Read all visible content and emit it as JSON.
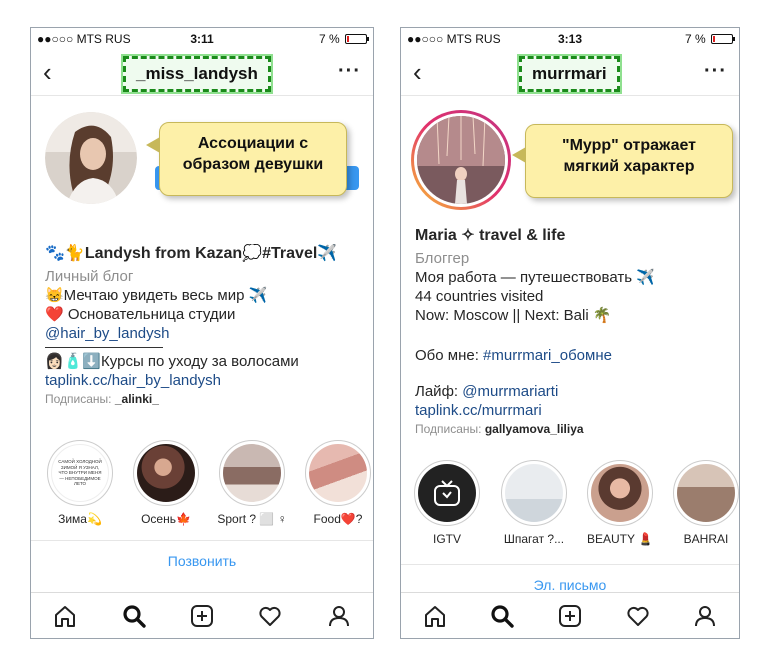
{
  "left": {
    "status": {
      "carrier": "●●○○○ MTS RUS",
      "time": "3:11",
      "battery_text": "7 %"
    },
    "username": "_miss_landysh",
    "callout": "Ассоциации с образом девушки",
    "bio": {
      "name_line": "🐾🐈Landysh from Kazan💭#Travel✈️",
      "category": "Личный блог",
      "line1": "😸Мечтаю увидеть весь мир ✈️",
      "line2": "❤️ Основательница студии",
      "handle": "@hair_by_landysh",
      "courses": "👩🏻🧴⬇️Курсы по уходу за волосами",
      "link": "taplink.cc/hair_by_landysh",
      "followed_label": "Подписаны:",
      "followed_user": "_alinki_"
    },
    "highlights": [
      {
        "label": "Зима💫",
        "text": "САМОЙ ХОЛОДНОЙ ЗИМОЙ Я УЗНАЛ, ЧТО ВНУТРИ МЕНЯ — НЕПОБЕДИМОЕ ЛЕТО"
      },
      {
        "label": "Осень🍁"
      },
      {
        "label": "Sport ? ⬜ ♀"
      },
      {
        "label": "Food❤️?"
      }
    ],
    "action": "Позвонить"
  },
  "right": {
    "status": {
      "carrier": "●●○○○ MTS RUS",
      "time": "3:13",
      "battery_text": "7 %"
    },
    "username": "murrmari",
    "callout": "\"Мурр\" отражает мягкий характер",
    "bio": {
      "name_line": "Maria ✧ travel & life",
      "category": "Блоггер",
      "line1": "Моя работа — путешествовать ✈️",
      "line2": "44 countries visited",
      "line3": "Now: Moscow || Next: Bali 🌴",
      "about_label": "Обо мне:",
      "about_tag": "#murrmari_обомне",
      "life_label": "Лайф:",
      "life_handle": "@murrmariarti",
      "link": "taplink.cc/murrmari",
      "followed_label": "Подписаны:",
      "followed_user": "gallyamova_liliya"
    },
    "highlights": [
      {
        "label": "IGTV"
      },
      {
        "label": "Шпагат ?..."
      },
      {
        "label": "BEAUTY 💄"
      },
      {
        "label": "BAHRAI"
      }
    ],
    "action": "Эл. письмо"
  },
  "colors": {
    "link": "#1d4b87",
    "action": "#3897f0",
    "callout_bg": "#fdf0a8",
    "highlight_box": "#1a8a1a",
    "battery_low": "#e02020"
  },
  "battery_level": 0.07,
  "icons": [
    "back-icon",
    "more-icon",
    "home-icon",
    "search-icon",
    "add-icon",
    "heart-icon",
    "profile-icon",
    "igtv-icon"
  ]
}
